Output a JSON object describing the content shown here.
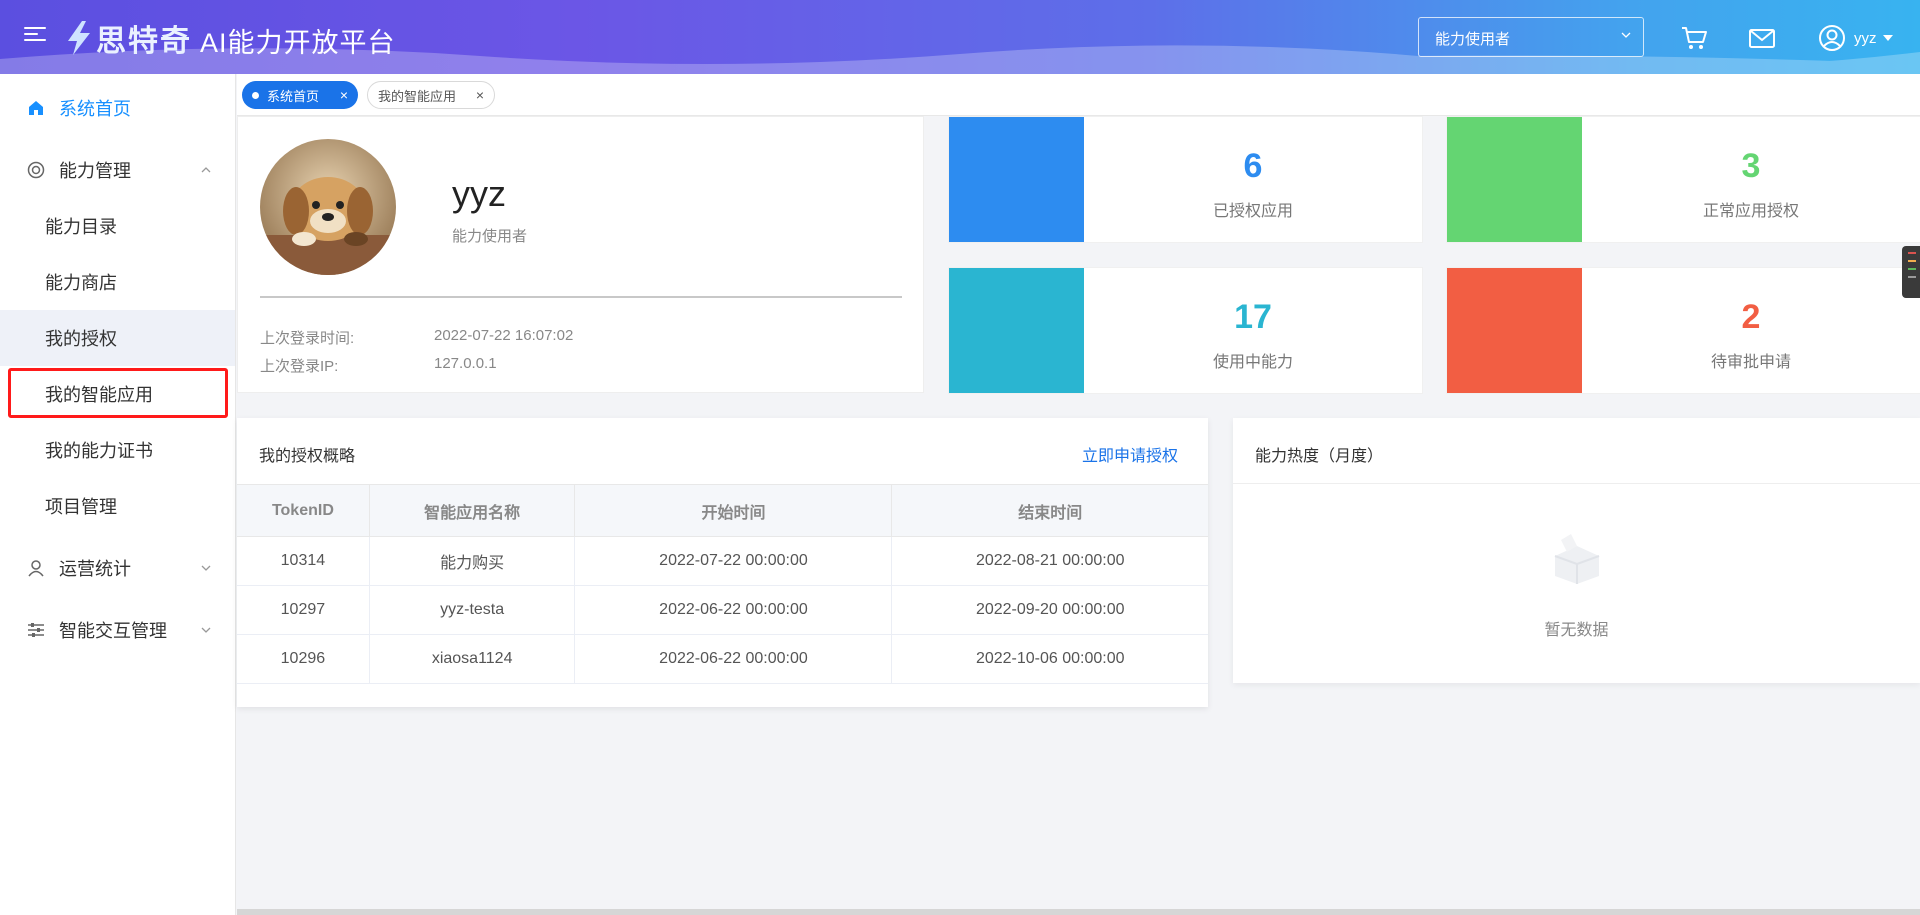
{
  "header": {
    "logo_text": "思特奇",
    "platform_title": "AI能力开放平台",
    "role_select_value": "能力使用者",
    "username": "yyz"
  },
  "sidebar": {
    "home": "系统首页",
    "capability_mgmt": "能力管理",
    "sub_items": [
      "能力目录",
      "能力商店",
      "我的授权",
      "我的智能应用",
      "我的能力证书",
      "项目管理"
    ],
    "ops_stats": "运营统计",
    "interaction_mgmt": "智能交互管理"
  },
  "tabs": [
    {
      "label": "系统首页",
      "active": true
    },
    {
      "label": "我的智能应用",
      "active": false
    }
  ],
  "profile": {
    "name": "yyz",
    "role": "能力使用者",
    "last_login_time_label": "上次登录时间:",
    "last_login_time": "2022-07-22 16:07:02",
    "last_login_ip_label": "上次登录IP:",
    "last_login_ip": "127.0.0.1"
  },
  "stats": [
    {
      "value": "6",
      "label": "已授权应用",
      "color": "#2d8cf0"
    },
    {
      "value": "3",
      "label": "正常应用授权",
      "color": "#64d572"
    },
    {
      "value": "17",
      "label": "使用中能力",
      "color": "#2ab5d1"
    },
    {
      "value": "2",
      "label": "待审批申请",
      "color": "#f25e43"
    }
  ],
  "auth_overview": {
    "title": "我的授权概略",
    "apply_link": "立即申请授权",
    "columns": [
      "TokenID",
      "智能应用名称",
      "开始时间",
      "结束时间"
    ],
    "rows": [
      [
        "10314",
        "能力购买",
        "2022-07-22 00:00:00",
        "2022-08-21 00:00:00"
      ],
      [
        "10297",
        "yyz-testa",
        "2022-06-22 00:00:00",
        "2022-09-20 00:00:00"
      ],
      [
        "10296",
        "xiaosa1124",
        "2022-06-22 00:00:00",
        "2022-10-06 00:00:00"
      ]
    ]
  },
  "heat": {
    "title": "能力热度（月度）",
    "empty_text": "暂无数据"
  }
}
